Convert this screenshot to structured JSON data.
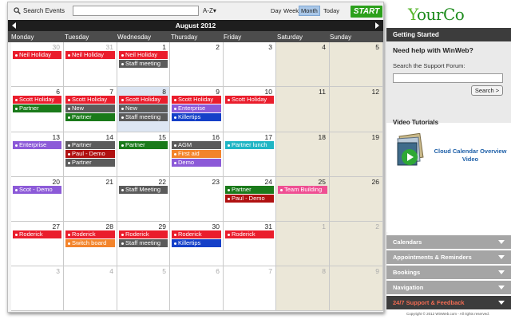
{
  "toolbar": {
    "search_label": "Search Events",
    "search_value": "",
    "sort_label": "A-Z",
    "views": [
      "Day",
      "Week",
      "Month",
      "Today"
    ],
    "active_view": "Month",
    "start_label": "START"
  },
  "calendar": {
    "month_title": "August 2012",
    "weekdays": [
      "Monday",
      "Tuesday",
      "Wednesday",
      "Thursday",
      "Friday",
      "Saturday",
      "Sunday"
    ],
    "weeks": [
      [
        {
          "day": "30",
          "other": true,
          "events": [
            {
              "t": "Neil Holiday",
              "c": "red"
            }
          ]
        },
        {
          "day": "31",
          "other": true,
          "events": [
            {
              "t": "Neil Holiday",
              "c": "red"
            }
          ]
        },
        {
          "day": "1",
          "events": [
            {
              "t": "Neil Holiday",
              "c": "red"
            },
            {
              "t": "Staff meeting",
              "c": "gray"
            }
          ]
        },
        {
          "day": "2",
          "events": []
        },
        {
          "day": "3",
          "events": []
        },
        {
          "day": "4",
          "weekend": true,
          "events": []
        },
        {
          "day": "5",
          "weekend": true,
          "events": []
        }
      ],
      [
        {
          "day": "6",
          "events": [
            {
              "t": "Scott Holiday",
              "c": "red"
            },
            {
              "t": "Partner",
              "c": "green"
            }
          ]
        },
        {
          "day": "7",
          "events": [
            {
              "t": "Scott Holiday",
              "c": "red"
            },
            {
              "t": "New",
              "c": "gray"
            },
            {
              "t": "Partner",
              "c": "green"
            }
          ]
        },
        {
          "day": "8",
          "today": true,
          "events": [
            {
              "t": "Scott Holiday",
              "c": "red"
            },
            {
              "t": "New",
              "c": "gray"
            },
            {
              "t": "Staff meeting",
              "c": "gray"
            }
          ]
        },
        {
          "day": "9",
          "events": [
            {
              "t": "Scott Holiday",
              "c": "red"
            },
            {
              "t": "Enterprise",
              "c": "purple"
            },
            {
              "t": "Killertips",
              "c": "blue"
            }
          ]
        },
        {
          "day": "10",
          "events": [
            {
              "t": "Scott Holiday",
              "c": "red"
            }
          ]
        },
        {
          "day": "11",
          "weekend": true,
          "events": []
        },
        {
          "day": "12",
          "weekend": true,
          "events": []
        }
      ],
      [
        {
          "day": "13",
          "events": [
            {
              "t": "Enterprise",
              "c": "purple"
            }
          ]
        },
        {
          "day": "14",
          "events": [
            {
              "t": "Partner",
              "c": "gray"
            },
            {
              "t": "Paul - Demo",
              "c": "darkred"
            },
            {
              "t": "Partner",
              "c": "gray"
            }
          ]
        },
        {
          "day": "15",
          "events": [
            {
              "t": "Partner",
              "c": "green"
            }
          ]
        },
        {
          "day": "16",
          "events": [
            {
              "t": "AGM",
              "c": "gray"
            },
            {
              "t": "First aid",
              "c": "orange"
            },
            {
              "t": "Demo",
              "c": "purple"
            }
          ]
        },
        {
          "day": "17",
          "events": [
            {
              "t": "Partner lunch",
              "c": "cyan"
            }
          ]
        },
        {
          "day": "18",
          "weekend": true,
          "events": []
        },
        {
          "day": "19",
          "weekend": true,
          "events": []
        }
      ],
      [
        {
          "day": "20",
          "events": [
            {
              "t": "Scot - Demo",
              "c": "purple"
            }
          ]
        },
        {
          "day": "21",
          "events": []
        },
        {
          "day": "22",
          "events": [
            {
              "t": "Staff Meeting",
              "c": "gray"
            }
          ]
        },
        {
          "day": "23",
          "events": []
        },
        {
          "day": "24",
          "events": [
            {
              "t": "Partner",
              "c": "green"
            },
            {
              "t": "Paul - Demo",
              "c": "darkred"
            }
          ]
        },
        {
          "day": "25",
          "weekend": true,
          "events": [
            {
              "t": "Team Building",
              "c": "pink"
            }
          ]
        },
        {
          "day": "26",
          "weekend": true,
          "events": []
        }
      ],
      [
        {
          "day": "27",
          "events": [
            {
              "t": "Roderick",
              "c": "red"
            }
          ]
        },
        {
          "day": "28",
          "events": [
            {
              "t": "Roderick",
              "c": "red"
            },
            {
              "t": "Switch board",
              "c": "orange"
            }
          ]
        },
        {
          "day": "29",
          "events": [
            {
              "t": "Roderick",
              "c": "red"
            },
            {
              "t": "Staff meeting",
              "c": "gray"
            }
          ]
        },
        {
          "day": "30",
          "events": [
            {
              "t": "Roderick",
              "c": "red"
            },
            {
              "t": "Killertips",
              "c": "blue"
            }
          ]
        },
        {
          "day": "31",
          "events": [
            {
              "t": "Roderick",
              "c": "red"
            }
          ]
        },
        {
          "day": "1",
          "weekend": true,
          "other": true,
          "events": []
        },
        {
          "day": "2",
          "weekend": true,
          "other": true,
          "events": []
        }
      ],
      [
        {
          "day": "3",
          "other": true,
          "events": []
        },
        {
          "day": "4",
          "other": true,
          "events": []
        },
        {
          "day": "5",
          "other": true,
          "events": []
        },
        {
          "day": "6",
          "other": true,
          "events": []
        },
        {
          "day": "7",
          "other": true,
          "events": []
        },
        {
          "day": "8",
          "weekend": true,
          "other": true,
          "events": []
        },
        {
          "day": "9",
          "weekend": true,
          "other": true,
          "events": []
        }
      ]
    ]
  },
  "sidebar": {
    "logo_first": "Y",
    "logo_rest": "ourCo",
    "getting_started": "Getting Started",
    "help_title": "Need help with WinWeb?",
    "support_label": "Search the Support Forum:",
    "support_value": "",
    "search_button": "Search >",
    "video_title": "Video Tutorials",
    "video_link": "Cloud Calendar Overview Video",
    "accordion": [
      "Calendars",
      "Appointments & Reminders",
      "Bookings",
      "Navigation",
      "24/7 Support & Feedback"
    ],
    "copyright": "Copyright © 2012 WinWeb.com - All rights reserved."
  },
  "colors": {
    "red": "#ea1d2c",
    "gray": "#5b5b5b",
    "green": "#1a7a1a",
    "purple": "#8c5ad8",
    "blue": "#1540c8",
    "orange": "#f3842b",
    "darkred": "#b01111",
    "cyan": "#1fb5c4",
    "pink": "#ef4f93",
    "start": "#2ca01c",
    "weekend": "#ebe7d8",
    "today": "#dde6f3"
  }
}
